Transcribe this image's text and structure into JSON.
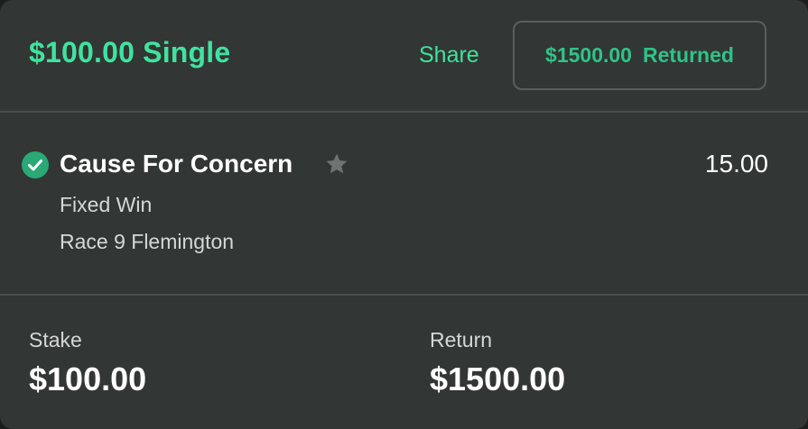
{
  "header": {
    "title": "$100.00 Single",
    "share_label": "Share",
    "returned_amount": "$1500.00",
    "returned_label": "Returned"
  },
  "selection": {
    "status_icon": "check-circle-icon",
    "name": "Cause For Concern",
    "favorite_icon": "star-icon",
    "odds": "15.00",
    "bet_type": "Fixed Win",
    "race": "Race 9 Flemington"
  },
  "summary": {
    "stake_label": "Stake",
    "stake_value": "$100.00",
    "return_label": "Return",
    "return_value": "$1500.00"
  },
  "colors": {
    "accent": "#3fe39f",
    "card_background": "#323634",
    "success": "#2aa876"
  }
}
